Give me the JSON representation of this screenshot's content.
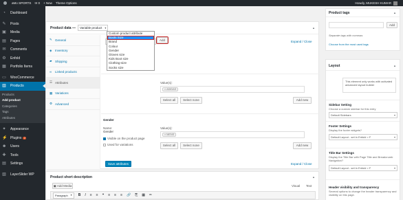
{
  "adminbar": {
    "site_name": "aMo SPORTS",
    "comments": "0",
    "new_label": "+ New",
    "theme_options": "Theme Options",
    "greeting": "Howdy, MUKESH KUMAR"
  },
  "menu": {
    "top_items": [
      {
        "label": "Dashboard",
        "icon": "dashboard-icon"
      }
    ],
    "items_a": [
      {
        "label": "Posts",
        "icon": "pin-icon"
      },
      {
        "label": "Media",
        "icon": "media-icon"
      },
      {
        "label": "Pages",
        "icon": "pages-icon"
      },
      {
        "label": "Comments",
        "icon": "comments-icon"
      },
      {
        "label": "Enfold",
        "icon": "enfold-icon"
      },
      {
        "label": "Portfolio Items",
        "icon": "portfolio-icon"
      }
    ],
    "woocommerce": "WooCommerce",
    "products": "Products",
    "submenu": [
      "Products",
      "Add product",
      "Categories",
      "Tags",
      "Attributes"
    ],
    "items_b": [
      {
        "label": "Appearance",
        "icon": "appearance-icon"
      },
      {
        "label": "Plugins",
        "icon": "plugins-icon",
        "badge": "2"
      },
      {
        "label": "Users",
        "icon": "users-icon"
      },
      {
        "label": "Tools",
        "icon": "tools-icon"
      },
      {
        "label": "Settings",
        "icon": "settings-icon"
      }
    ],
    "layerslider": "LayerSlider WP"
  },
  "product_data": {
    "title": "Product data —",
    "type_select": "Variable product",
    "tabs": [
      {
        "label": "General",
        "icon": "wrench-icon"
      },
      {
        "label": "Inventory",
        "icon": "inventory-icon"
      },
      {
        "label": "Shipping",
        "icon": "truck-icon"
      },
      {
        "label": "Linked products",
        "icon": "link-icon"
      },
      {
        "label": "Attributes",
        "icon": "list-icon"
      },
      {
        "label": "Variations",
        "icon": "grid-icon"
      },
      {
        "label": "Advanced",
        "icon": "gear-icon"
      }
    ],
    "attr_select": "Custom product attribute",
    "add_button": "Add",
    "expand_close": "Expand / Close",
    "dropdown_options": [
      "Custom product attribute",
      "Boots Size",
      "Brand",
      "Colour",
      "Gender",
      "Gloves size",
      "Kids Boot size",
      "Clothing-size",
      "Socks size"
    ],
    "section1": {
      "values_label": "Value(s):",
      "token": "× ADIDAS",
      "select_all": "Select all",
      "select_none": "Select none",
      "add_new": "Add new"
    },
    "section2": {
      "heading": "Gender",
      "name_label": "Name:",
      "name_value": "Gender",
      "values_label": "Value(s):",
      "token": "× MENS",
      "visible_label": "Visible on the product page",
      "variations_label": "Used for variations",
      "select_all": "Select all",
      "select_none": "Select none",
      "add_new": "Add new"
    },
    "save_button": "Save attributes"
  },
  "short_desc": {
    "title": "Product short description",
    "add_media": "Add Media",
    "visual": "Visual",
    "text": "Text",
    "paragraph": "Paragraph",
    "toolbar": [
      "B",
      "I",
      "≡",
      "≡",
      "❝",
      "≡",
      "≡",
      "≡",
      "🔗",
      "⎘",
      "▦",
      "✏"
    ]
  },
  "tags_box": {
    "title": "Product tags",
    "add": "Add",
    "hint": "Separate tags with commas",
    "choose": "Choose from the most used tags"
  },
  "layout_box": {
    "title": "Layout",
    "notice": "This element only works with activated advanced layout builder",
    "sidebar_heading": "Sidebar Setting",
    "sidebar_desc": "Choose a custom sidebar for this entry",
    "sidebar_select": "Default Sidebars",
    "footer_heading": "Footer Settings",
    "footer_desc": "Display the footer widgets?",
    "footer_select": "Default Layout - set in Enfold > F",
    "titlebar_heading": "Title Bar Settings",
    "titlebar_desc": "Display the Title Bar with Page Title and Breadcrumb Navigation?",
    "titlebar_select": "Default Layout - set in Enfold > F",
    "header_heading": "Header visibility and transparency",
    "header_desc": "Several options to change the header transparency and visibility on this page."
  },
  "colors": {
    "accent": "#0073aa",
    "menu_bg": "#23282d",
    "highlight_box": "#c62828"
  }
}
